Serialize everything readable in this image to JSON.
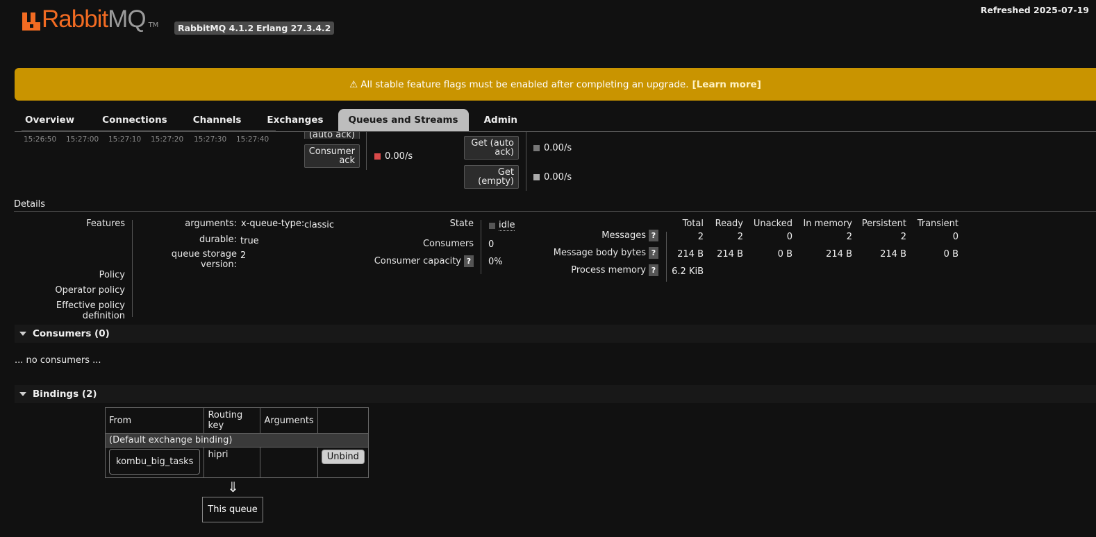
{
  "header": {
    "logo_word1": "Rabbit",
    "logo_word2": "MQ",
    "logo_tm": "TM",
    "rabbitmq_version": "RabbitMQ 4.1.2",
    "erlang_version": "Erlang 27.3.4.2",
    "refreshed": "Refreshed 2025-07-19"
  },
  "banner": {
    "icon": "⚠",
    "text": "All stable feature flags must be enabled after completing an upgrade.",
    "link": "[Learn more]"
  },
  "tabs": [
    "Overview",
    "Connections",
    "Channels",
    "Exchanges",
    "Queues and Streams",
    "Admin"
  ],
  "active_tab": "Queues and Streams",
  "chart_remnant": {
    "times": [
      "15:26:50",
      "15:27:00",
      "15:27:10",
      "15:27:20",
      "15:27:30",
      "15:27:40"
    ],
    "buttons": {
      "auto_ack_partial": "(auto ack)",
      "consumer_ack": "Consumer ack",
      "get_auto_ack": "Get (auto ack)",
      "get_empty": "Get (empty)"
    },
    "rates": {
      "consumer_ack": "0.00/s",
      "get_auto_ack": "0.00/s",
      "get_empty": "0.00/s"
    },
    "colors": {
      "consumer_ack": "#d94a4a",
      "get_auto_ack": "#777777",
      "get_empty": "#aaaaaa"
    }
  },
  "details": {
    "title": "Details",
    "features_label": "Features",
    "policy_label": "Policy",
    "operator_policy_label": "Operator policy",
    "effective_policy_label": "Effective policy definition",
    "features": [
      {
        "key": "arguments:",
        "sub": "x-queue-type:",
        "value": "classic"
      },
      {
        "key": "durable:",
        "sub": "",
        "value": "true"
      },
      {
        "key": "queue storage version:",
        "sub": "",
        "value": "2"
      }
    ],
    "state_label": "State",
    "state_value": "idle",
    "consumers_label": "Consumers",
    "consumers_value": "0",
    "consumer_capacity_label": "Consumer capacity",
    "consumer_capacity_value": "0%",
    "help": "?"
  },
  "messages_table": {
    "columns": [
      "Total",
      "Ready",
      "Unacked",
      "In memory",
      "Persistent",
      "Transient"
    ],
    "rows": [
      {
        "label": "Messages",
        "values": [
          "2",
          "2",
          "0",
          "2",
          "2",
          "0"
        ]
      },
      {
        "label": "Message body bytes",
        "values": [
          "214 B",
          "214 B",
          "0 B",
          "214 B",
          "214 B",
          "0 B"
        ]
      },
      {
        "label": "Process memory",
        "values": [
          "6.2 KiB"
        ]
      }
    ]
  },
  "consumers": {
    "title": "Consumers (0)",
    "empty_text": "... no consumers ..."
  },
  "bindings": {
    "title": "Bindings (2)",
    "columns": [
      "From",
      "Routing key",
      "Arguments",
      ""
    ],
    "default_row": "(Default exchange binding)",
    "rows": [
      {
        "from": "kombu_big_tasks",
        "routing_key": "hipri",
        "arguments": "",
        "action": "Unbind"
      }
    ],
    "arrow": "⇓",
    "this_queue": "This queue"
  }
}
